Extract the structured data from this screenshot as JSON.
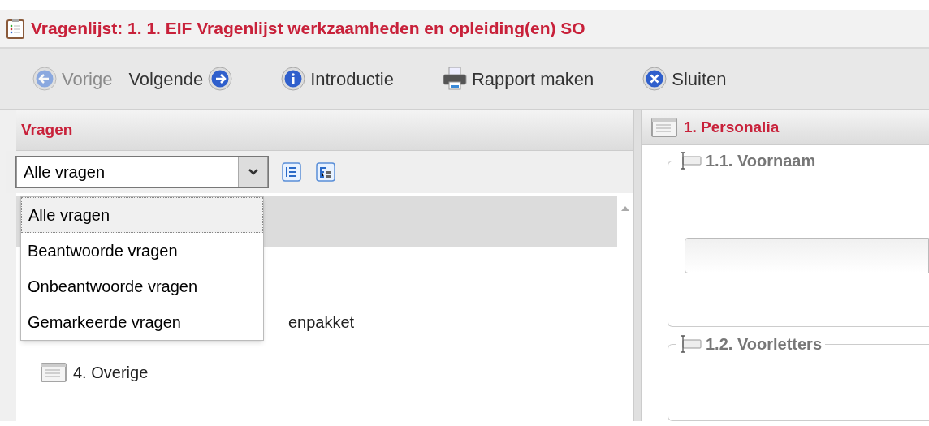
{
  "window": {
    "title": "Vragenlijst: 1. 1. EIF Vragenlijst werkzaamheden en opleiding(en) SO"
  },
  "toolbar": [
    {
      "kind": "prev",
      "label": "Vorige",
      "disabled": true
    },
    {
      "kind": "next",
      "label": "Volgende",
      "disabled": false
    },
    {
      "kind": "info",
      "label": "Introductie",
      "disabled": false
    },
    {
      "kind": "print",
      "label": "Rapport maken",
      "disabled": false
    },
    {
      "kind": "close",
      "label": "Sluiten",
      "disabled": false
    }
  ],
  "questions_panel": {
    "title": "Vragen",
    "filter": {
      "value": "Alle vragen",
      "expanded": true,
      "options": [
        {
          "label": "Alle vragen",
          "selected": true
        },
        {
          "label": "Beantwoorde vragen",
          "selected": false
        },
        {
          "label": "Onbeantwoorde vragen",
          "selected": false
        },
        {
          "label": "Gemarkeerde vragen",
          "selected": false
        }
      ]
    },
    "tree": [
      {
        "kind": "hidden",
        "selected": true
      },
      {
        "kind": "partial",
        "label": "enpakket",
        "selected": false
      },
      {
        "kind": "item",
        "label": "4. Overige",
        "selected": false
      }
    ]
  },
  "section": {
    "title": "1. Personalia",
    "fields": [
      {
        "label": "1.1. Voornaam",
        "value_shown": true
      },
      {
        "label": "1.2. Voorletters",
        "value_shown": false
      }
    ]
  }
}
